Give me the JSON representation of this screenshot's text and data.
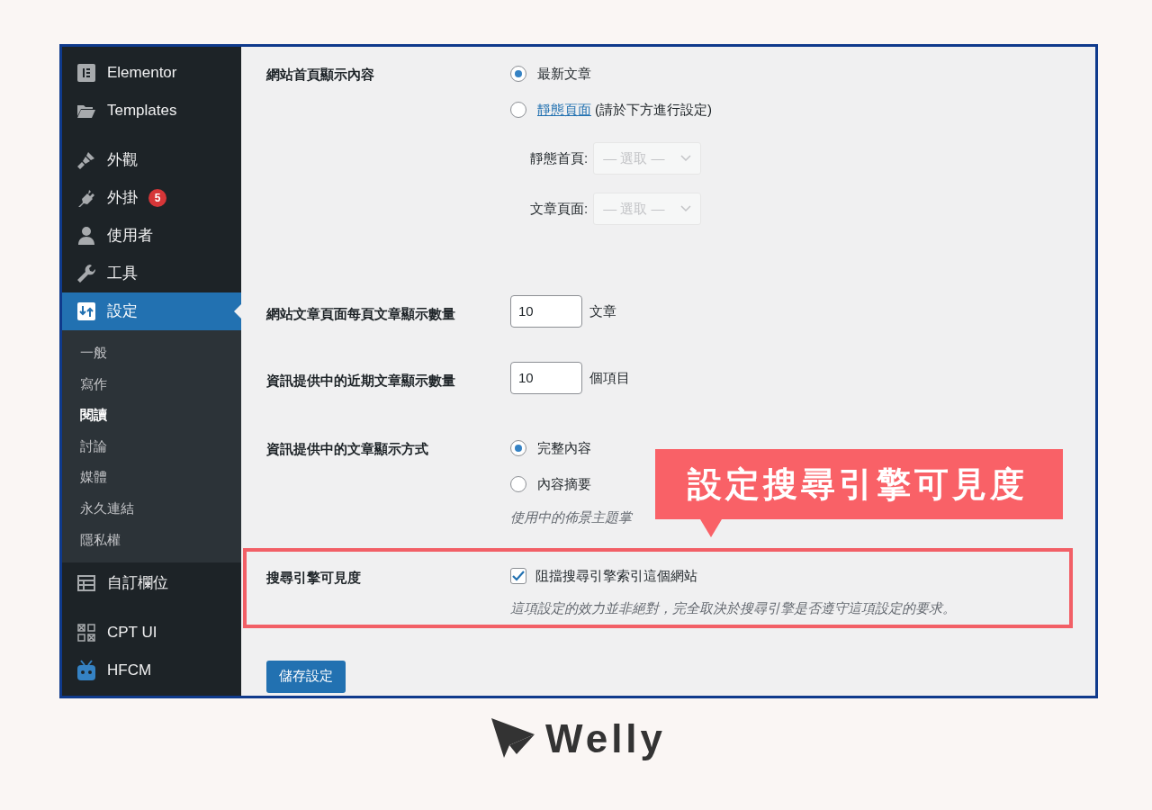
{
  "sidebar": {
    "items": [
      {
        "label": "Elementor",
        "selected": false
      },
      {
        "label": "Templates",
        "selected": false
      },
      {
        "label": "外觀",
        "selected": false
      },
      {
        "label": "外掛",
        "selected": false,
        "badge": "5"
      },
      {
        "label": "使用者",
        "selected": false
      },
      {
        "label": "工具",
        "selected": false
      },
      {
        "label": "設定",
        "selected": true,
        "children": [
          {
            "label": "一般",
            "selected": false
          },
          {
            "label": "寫作",
            "selected": false
          },
          {
            "label": "閱讀",
            "selected": true
          },
          {
            "label": "討論",
            "selected": false
          },
          {
            "label": "媒體",
            "selected": false
          },
          {
            "label": "永久連結",
            "selected": false
          },
          {
            "label": "隱私權",
            "selected": false
          }
        ]
      },
      {
        "label": "自訂欄位",
        "selected": false
      },
      {
        "label": "CPT UI",
        "selected": false
      },
      {
        "label": "HFCM",
        "selected": false
      }
    ]
  },
  "settings": [
    {
      "kind": "radios",
      "label": "網站首頁顯示內容",
      "options": [
        {
          "label": "最新文章",
          "selected": true
        },
        {
          "link": "靜態頁面",
          "note": "(請於下方進行設定)",
          "selected": false
        }
      ],
      "selects": [
        {
          "label": "靜態首頁:",
          "placeholder": "— 選取 —"
        },
        {
          "label": "文章頁面:",
          "placeholder": "— 選取 —"
        }
      ]
    },
    {
      "kind": "number",
      "label": "網站文章頁面每頁文章顯示數量",
      "value": "10",
      "unit": "文章"
    },
    {
      "kind": "number",
      "label": "資訊提供中的近期文章顯示數量",
      "value": "10",
      "unit": "個項目"
    },
    {
      "kind": "radios",
      "label": "資訊提供中的文章顯示方式",
      "options": [
        {
          "label": "完整內容",
          "selected": true
        },
        {
          "label": "內容摘要",
          "selected": false
        }
      ],
      "hint": "使用中的佈景主題掌"
    },
    {
      "kind": "checkbox",
      "label": "搜尋引擎可見度",
      "highlighted": true,
      "option": "阻擋搜尋引擎索引這個網站",
      "checked": true,
      "description": "這項設定的效力並非絕對，完全取決於搜尋引擎是否遵守這項設定的要求。"
    }
  ],
  "save_button": "儲存設定",
  "callout": "設定搜尋引擎可見度",
  "logo": "Welly"
}
